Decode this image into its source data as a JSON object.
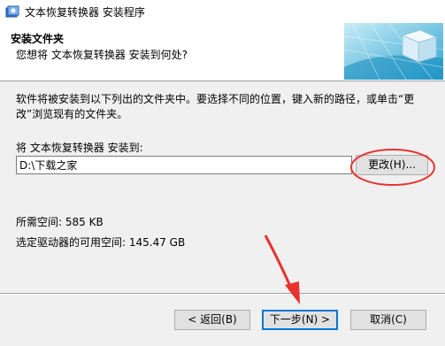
{
  "window": {
    "title": "文本恢复转换器 安装程序"
  },
  "header": {
    "title": "安装文件夹",
    "subtitle": "您想将 文本恢复转换器 安装到何处?"
  },
  "body": {
    "description": "软件将被安装到以下列出的文件夹中。要选择不同的位置，键入新的路径，或单击“更改”浏览现有的文件夹。",
    "dest_label": "将 文本恢复转换器 安装到:",
    "path_value": "D:\\下载之家",
    "browse_label": "更改(H)...",
    "space_required": "所需空间: 585 KB",
    "space_available": "选定驱动器的可用空间: 145.47 GB"
  },
  "footer": {
    "brand": "",
    "back_label": "< 返回(B)",
    "next_label": "下一步(N) >",
    "cancel_label": "取消(C)"
  },
  "colors": {
    "annotation": "#e8322d",
    "accent": "#0078d7",
    "window_bg": "#f0f0f0"
  }
}
